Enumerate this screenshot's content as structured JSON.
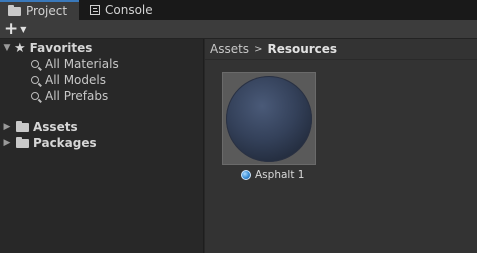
{
  "tabs": [
    {
      "label": "Project",
      "icon": "folder-icon",
      "active": true
    },
    {
      "label": "Console",
      "icon": "console-icon",
      "active": false
    }
  ],
  "toolbar": {
    "create_label": "+",
    "create_icon": "plus-icon"
  },
  "tree": {
    "favorites": {
      "label": "Favorites",
      "expanded": true,
      "items": [
        "All Materials",
        "All Models",
        "All Prefabs"
      ]
    },
    "roots": [
      {
        "label": "Assets",
        "expanded": false
      },
      {
        "label": "Packages",
        "expanded": false
      }
    ]
  },
  "breadcrumb": {
    "parts": [
      "Assets",
      "Resources"
    ],
    "separator": ">"
  },
  "assets": [
    {
      "name": "Asphalt 1",
      "type": "material",
      "color": "#34415a"
    }
  ],
  "colors": {
    "accent": "#3a79bb",
    "background": "#282828",
    "panel": "#333333"
  }
}
